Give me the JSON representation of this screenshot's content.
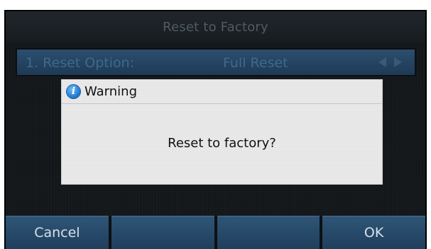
{
  "screen": {
    "title": "Reset to Factory"
  },
  "option": {
    "label": "1. Reset Option:",
    "value": "Full Reset",
    "left_arrow_icon": "triangle-left-icon",
    "right_arrow_icon": "triangle-right-icon"
  },
  "dialog": {
    "icon": "info-icon",
    "icon_glyph": "i",
    "title": "Warning",
    "message": "Reset to factory?"
  },
  "softkeys": [
    {
      "label": "Cancel"
    },
    {
      "label": ""
    },
    {
      "label": ""
    },
    {
      "label": "OK"
    }
  ],
  "colors": {
    "screen_bg": "#121619",
    "option_row": "#2c4e6e",
    "softkey": "#2f5576",
    "dialog_bg": "#e9e9e9",
    "info_icon": "#1b73c8"
  }
}
